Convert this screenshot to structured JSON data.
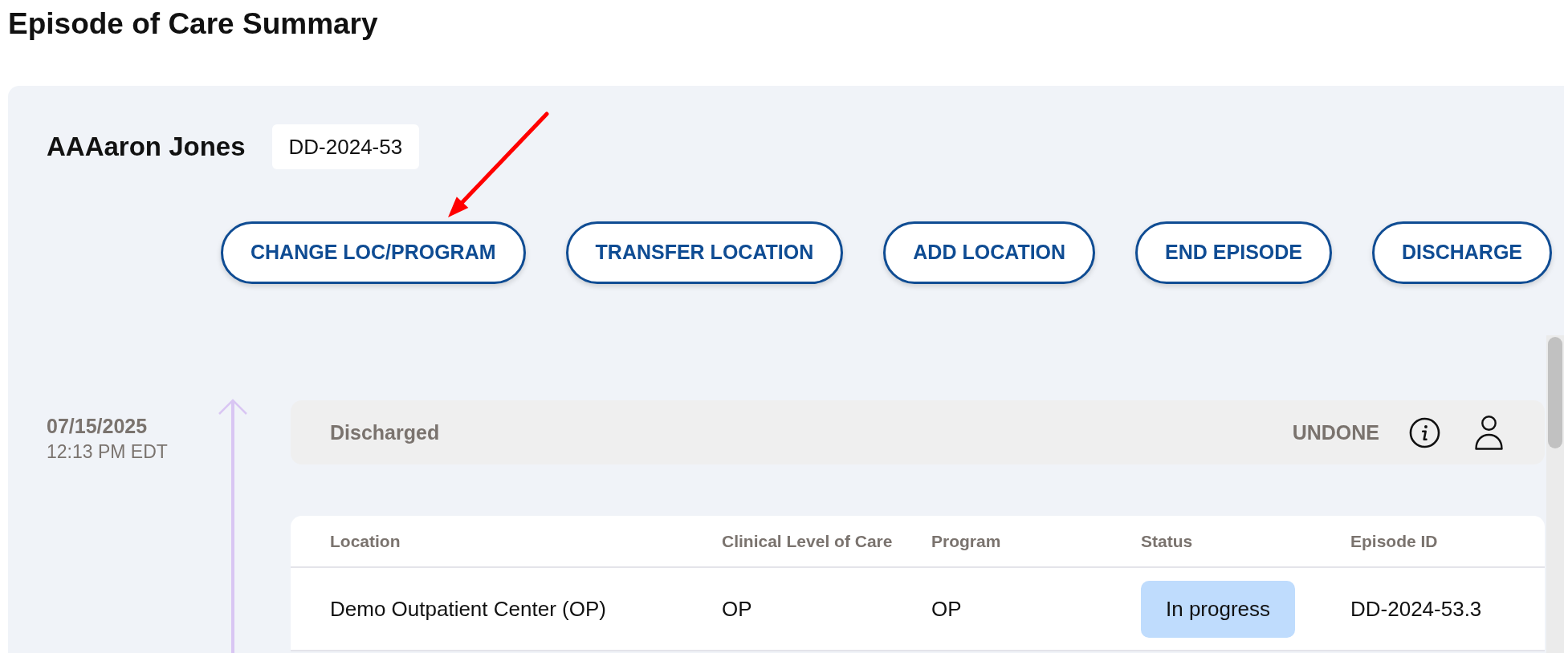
{
  "page": {
    "title": "Episode of Care Summary"
  },
  "patient": {
    "name": "AAAaron Jones",
    "id": "DD-2024-53"
  },
  "actions": [
    "CHANGE LOC/PROGRAM",
    "TRANSFER LOCATION",
    "ADD LOCATION",
    "END EPISODE",
    "DISCHARGE"
  ],
  "timeline": [
    {
      "date": "07/15/2025",
      "time": "12:13 PM EDT",
      "event": {
        "title": "Discharged",
        "status_label": "UNDONE"
      },
      "table": {
        "columns": [
          "Location",
          "Clinical Level of Care",
          "Program",
          "Status",
          "Episode ID"
        ],
        "rows": [
          {
            "cells": [
              {
                "kind": "text",
                "text": "Demo Outpatient Center (OP)"
              },
              {
                "kind": "text",
                "text": "OP"
              },
              {
                "kind": "text",
                "text": "OP"
              },
              {
                "kind": "status",
                "text": "In progress",
                "color": "#bfdcfd"
              },
              {
                "kind": "text",
                "text": "DD-2024-53.3"
              }
            ]
          }
        ]
      }
    }
  ]
}
